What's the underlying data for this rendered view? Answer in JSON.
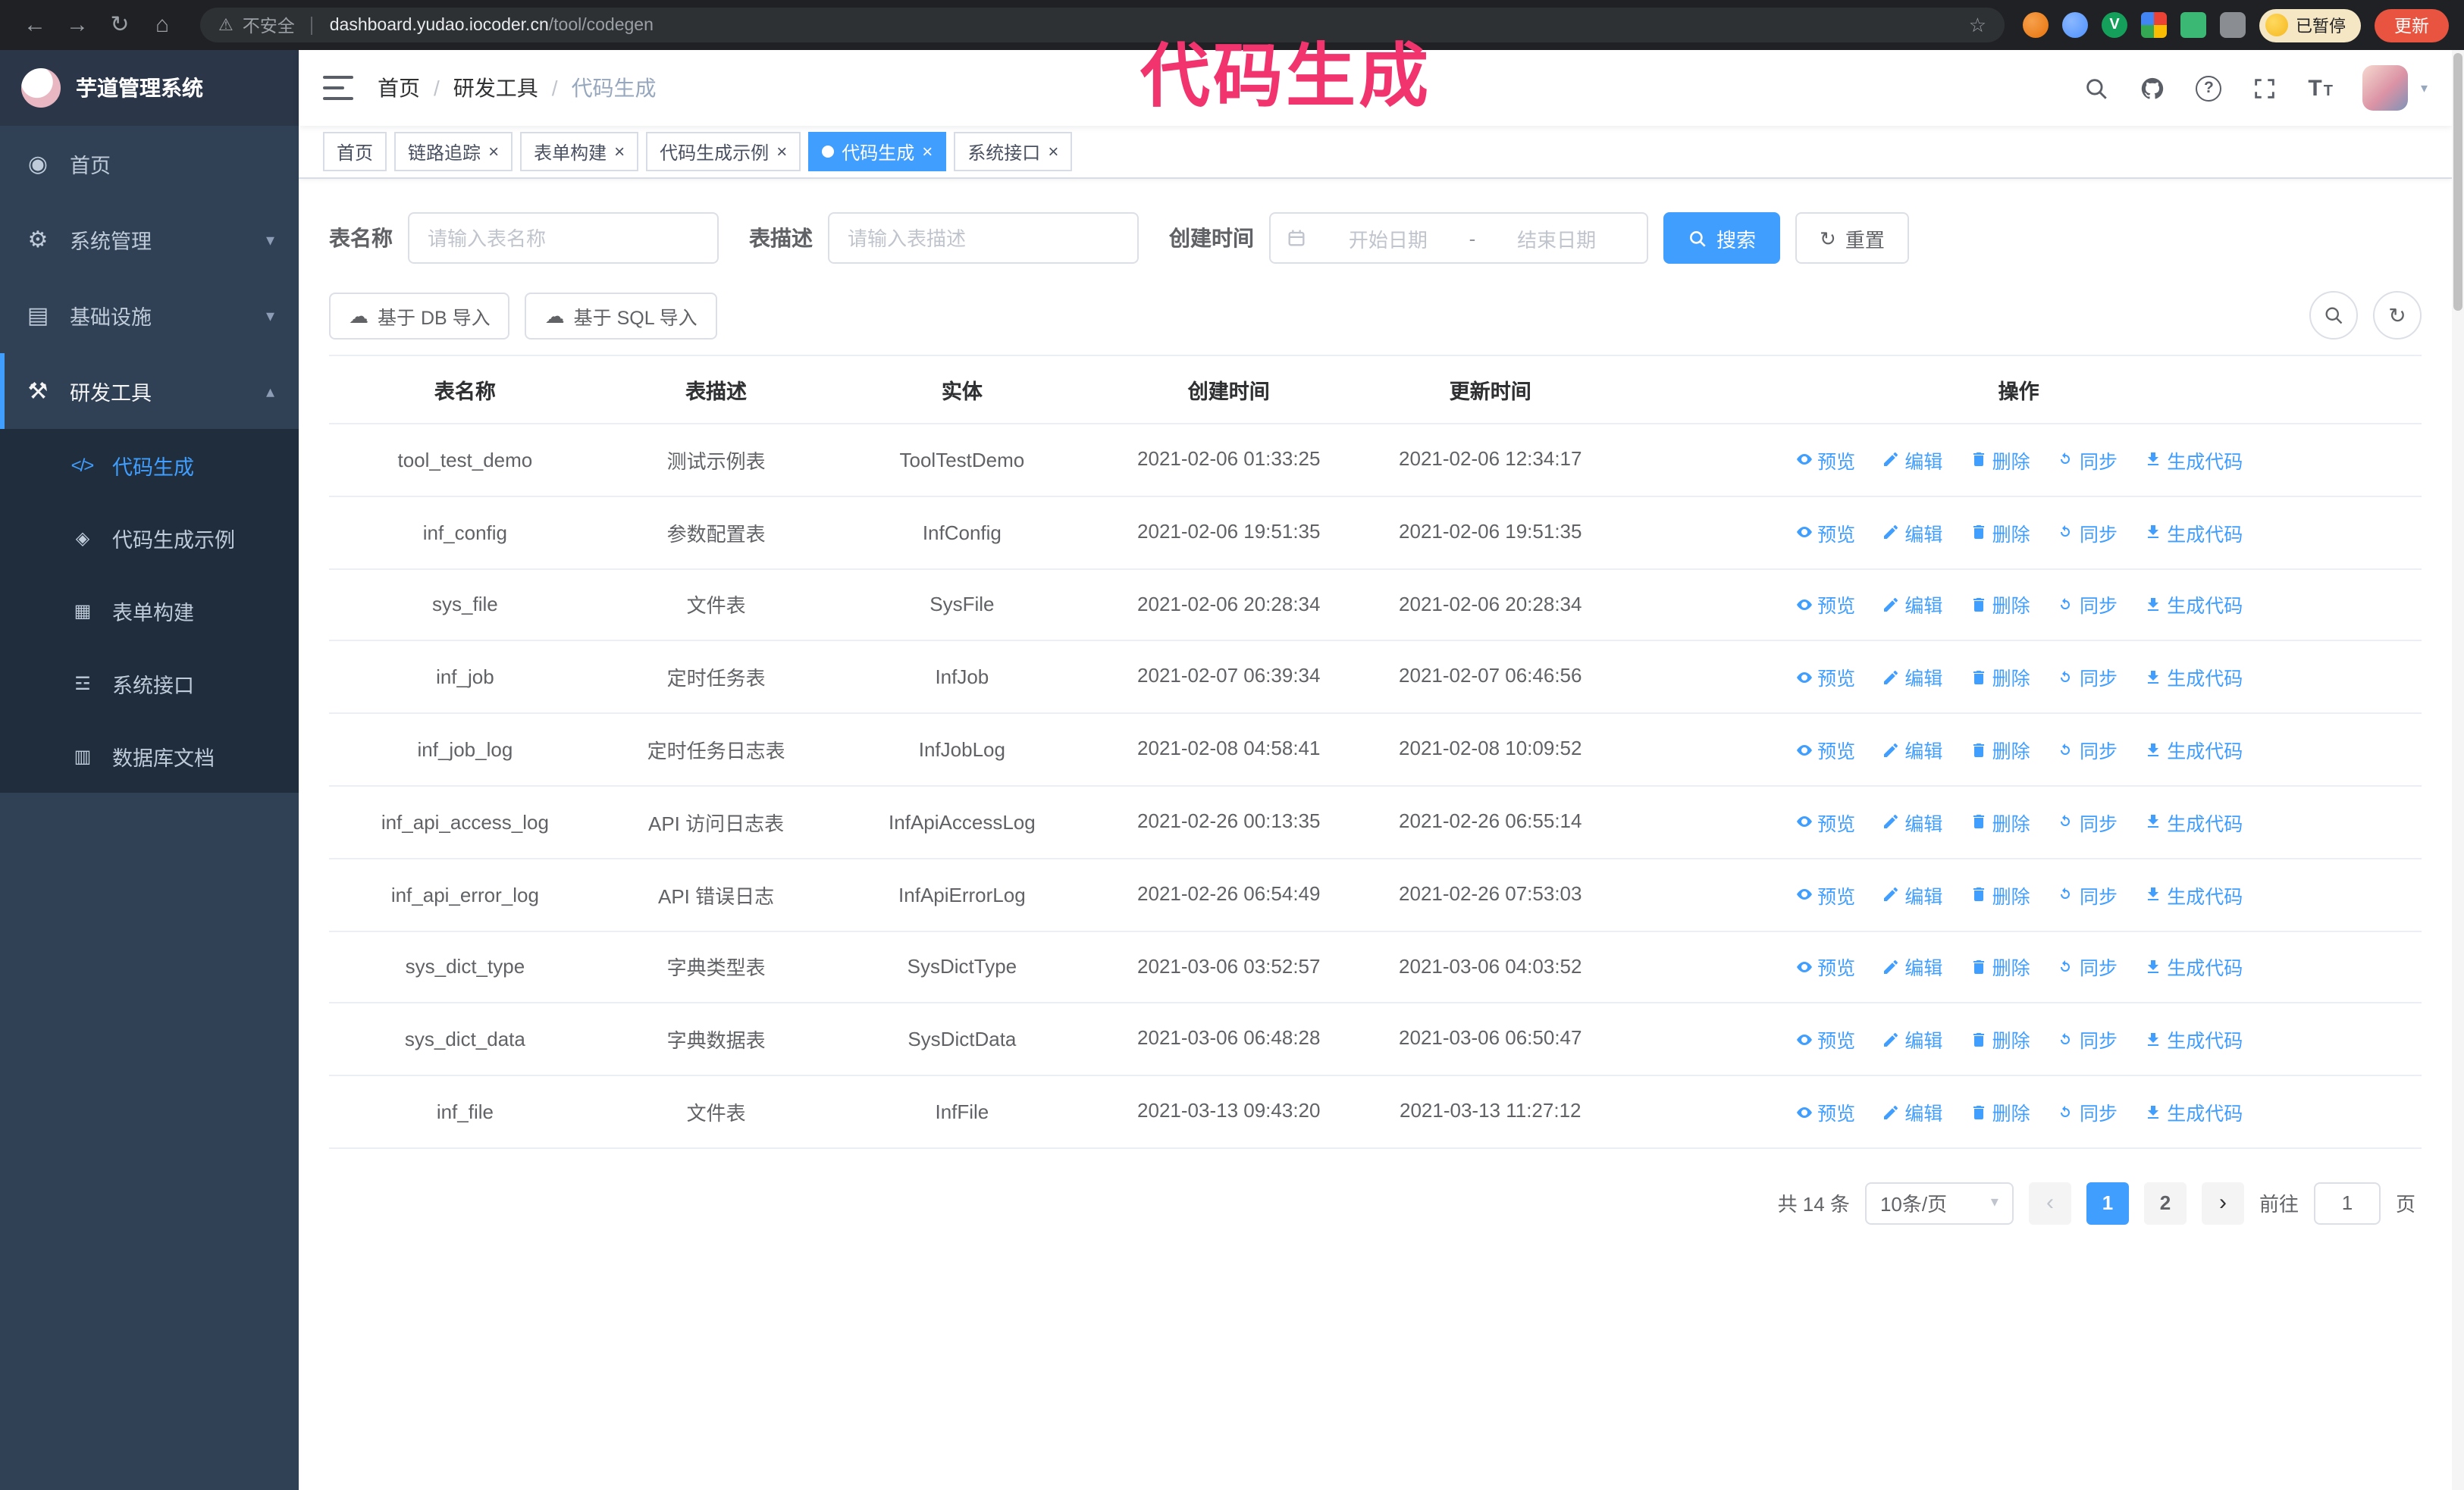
{
  "browser": {
    "security_label": "不安全",
    "url_host": "dashboard.yudao.iocoder.cn",
    "url_path": "/tool/codegen",
    "paused_badge": "已暂停",
    "update_button": "更新"
  },
  "annotation": "代码生成",
  "colors": {
    "accent": "#409eff",
    "annotation": "#f1336e",
    "sidebar_bg": "#304156",
    "submenu_bg": "#1f2d3d",
    "update_button_bg": "#e8543f"
  },
  "sidebar": {
    "title": "芋道管理系统",
    "items": [
      {
        "label": "首页",
        "icon": "home-icon",
        "expandable": false
      },
      {
        "label": "系统管理",
        "icon": "gear-icon",
        "expandable": true,
        "expanded": false
      },
      {
        "label": "基础设施",
        "icon": "infrastructure-icon",
        "expandable": true,
        "expanded": false
      },
      {
        "label": "研发工具",
        "icon": "tools-icon",
        "expandable": true,
        "expanded": true
      }
    ],
    "subitems": [
      {
        "label": "代码生成",
        "icon": "code-icon",
        "active": true
      },
      {
        "label": "代码生成示例",
        "icon": "example-icon",
        "active": false
      },
      {
        "label": "表单构建",
        "icon": "form-builder-icon",
        "active": false
      },
      {
        "label": "系统接口",
        "icon": "api-icon",
        "active": false
      },
      {
        "label": "数据库文档",
        "icon": "database-doc-icon",
        "active": false
      }
    ]
  },
  "header": {
    "breadcrumb": [
      "首页",
      "研发工具",
      "代码生成"
    ],
    "separator": "/"
  },
  "tabs": [
    {
      "label": "首页",
      "closable": false,
      "active": false
    },
    {
      "label": "链路追踪",
      "closable": true,
      "active": false
    },
    {
      "label": "表单构建",
      "closable": true,
      "active": false
    },
    {
      "label": "代码生成示例",
      "closable": true,
      "active": false
    },
    {
      "label": "代码生成",
      "closable": true,
      "active": true
    },
    {
      "label": "系统接口",
      "closable": true,
      "active": false
    }
  ],
  "filters": {
    "table_name_label": "表名称",
    "table_name_placeholder": "请输入表名称",
    "table_desc_label": "表描述",
    "table_desc_placeholder": "请输入表描述",
    "create_time_label": "创建时间",
    "date_start_placeholder": "开始日期",
    "date_separator": "-",
    "date_end_placeholder": "结束日期",
    "search_button": "搜索",
    "reset_button": "重置"
  },
  "toolbar": {
    "import_db": "基于 DB 导入",
    "import_sql": "基于 SQL 导入"
  },
  "table": {
    "columns": [
      "表名称",
      "表描述",
      "实体",
      "创建时间",
      "更新时间",
      "操作"
    ],
    "actions": [
      "预览",
      "编辑",
      "删除",
      "同步",
      "生成代码"
    ],
    "rows": [
      {
        "name": "tool_test_demo",
        "desc": "测试示例表",
        "entity": "ToolTestDemo",
        "created": "2021-02-06 01:33:25",
        "updated": "2021-02-06 12:34:17"
      },
      {
        "name": "inf_config",
        "desc": "参数配置表",
        "entity": "InfConfig",
        "created": "2021-02-06 19:51:35",
        "updated": "2021-02-06 19:51:35"
      },
      {
        "name": "sys_file",
        "desc": "文件表",
        "entity": "SysFile",
        "created": "2021-02-06 20:28:34",
        "updated": "2021-02-06 20:28:34"
      },
      {
        "name": "inf_job",
        "desc": "定时任务表",
        "entity": "InfJob",
        "created": "2021-02-07 06:39:34",
        "updated": "2021-02-07 06:46:56"
      },
      {
        "name": "inf_job_log",
        "desc": "定时任务日志表",
        "entity": "InfJobLog",
        "created": "2021-02-08 04:58:41",
        "updated": "2021-02-08 10:09:52"
      },
      {
        "name": "inf_api_access_log",
        "desc": "API 访问日志表",
        "entity": "InfApiAccessLog",
        "created": "2021-02-26 00:13:35",
        "updated": "2021-02-26 06:55:14"
      },
      {
        "name": "inf_api_error_log",
        "desc": "API 错误日志",
        "entity": "InfApiErrorLog",
        "created": "2021-02-26 06:54:49",
        "updated": "2021-02-26 07:53:03"
      },
      {
        "name": "sys_dict_type",
        "desc": "字典类型表",
        "entity": "SysDictType",
        "created": "2021-03-06 03:52:57",
        "updated": "2021-03-06 04:03:52"
      },
      {
        "name": "sys_dict_data",
        "desc": "字典数据表",
        "entity": "SysDictData",
        "created": "2021-03-06 06:48:28",
        "updated": "2021-03-06 06:50:47"
      },
      {
        "name": "inf_file",
        "desc": "文件表",
        "entity": "InfFile",
        "created": "2021-03-13 09:43:20",
        "updated": "2021-03-13 11:27:12"
      }
    ]
  },
  "pagination": {
    "total": "共 14 条",
    "page_size": "10条/页",
    "pages": [
      "1",
      "2"
    ],
    "current": "1",
    "goto_label": "前往",
    "goto_value": "1",
    "page_unit": "页"
  },
  "glyphs": {
    "back": "←",
    "forward": "→",
    "reload": "↻",
    "home": "⌂",
    "warning": "⚠",
    "star": "☆",
    "ext_v": "V",
    "menu_home": "◉",
    "menu_system": "⚙",
    "menu_infra": "▤",
    "menu_tools": "⚒",
    "sub_codegen": "</>",
    "sub_example": "◈",
    "sub_form": "▦",
    "sub_api": "☲",
    "sub_db": "▥",
    "chev_down": "▾",
    "chev_up": "▴",
    "question": "?",
    "font_size_big": "T",
    "font_size_small": "T",
    "cloud": "☁",
    "refresh": "↻",
    "caret": "▾",
    "prev": "‹",
    "next": "›",
    "close": "×"
  }
}
